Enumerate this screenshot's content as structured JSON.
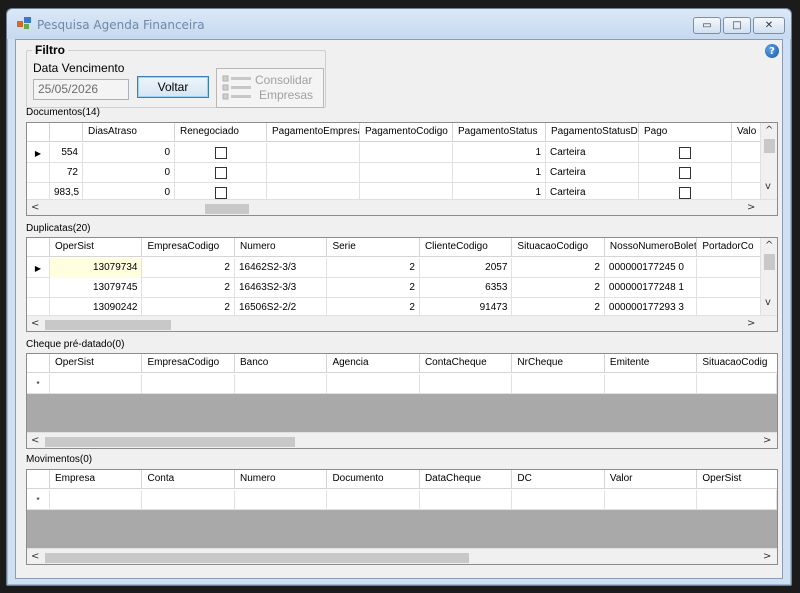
{
  "window": {
    "title": "Pesquisa Agenda Financeira",
    "controls": {
      "minimize": "▭",
      "maximize": "□",
      "close": "✕"
    }
  },
  "filter": {
    "legend": "Filtro",
    "date_label": "Data Vencimento",
    "date_value": "25/05/2026",
    "voltar_label": "Voltar",
    "consolidar_line1": "Consolidar",
    "consolidar_line2": "Empresas",
    "help": "?"
  },
  "documentos": {
    "label": "Documentos(14)",
    "columns": [
      "DiasAtraso",
      "Renegociado",
      "PagamentoEmpresa",
      "PagamentoCodigo",
      "PagamentoStatus",
      "PagamentoStatusD",
      "Pago",
      "Valo"
    ],
    "rows": [
      {
        "first": "554",
        "dias": "0",
        "status": "1",
        "statusd": "Carteira"
      },
      {
        "first": "72",
        "dias": "0",
        "status": "1",
        "statusd": "Carteira"
      },
      {
        "first": "983,5",
        "dias": "0",
        "status": "1",
        "statusd": "Carteira"
      }
    ]
  },
  "duplicatas": {
    "label": "Duplicatas(20)",
    "columns": [
      "OperSist",
      "EmpresaCodigo",
      "Numero",
      "Serie",
      "ClienteCodigo",
      "SituacaoCodigo",
      "NossoNumeroBolet",
      "PortadorCo"
    ],
    "rows": [
      {
        "opersist": "13079734",
        "empresa": "2",
        "numero": "16462S2-3/3",
        "serie": "2",
        "cliente": "2057",
        "situacao": "2",
        "nosso": "000000177245 0"
      },
      {
        "opersist": "13079745",
        "empresa": "2",
        "numero": "16463S2-3/3",
        "serie": "2",
        "cliente": "6353",
        "situacao": "2",
        "nosso": "000000177248 1"
      },
      {
        "opersist": "13090242",
        "empresa": "2",
        "numero": "16506S2-2/2",
        "serie": "2",
        "cliente": "91473",
        "situacao": "2",
        "nosso": "000000177293 3"
      }
    ]
  },
  "cheque": {
    "label": "Cheque pré-datado(0)",
    "columns": [
      "OperSist",
      "EmpresaCodigo",
      "Banco",
      "Agencia",
      "ContaCheque",
      "NrCheque",
      "Emitente",
      "SituacaoCodig"
    ]
  },
  "movimentos": {
    "label": "Movimentos(0)",
    "columns": [
      "Empresa",
      "Conta",
      "Numero",
      "Documento",
      "DataCheque",
      "DC",
      "Valor",
      "OperSist"
    ]
  },
  "glyphs": {
    "row_pointer": "▶",
    "new_row": "*",
    "left": "<",
    "right": ">",
    "up": "^",
    "down": "v"
  }
}
